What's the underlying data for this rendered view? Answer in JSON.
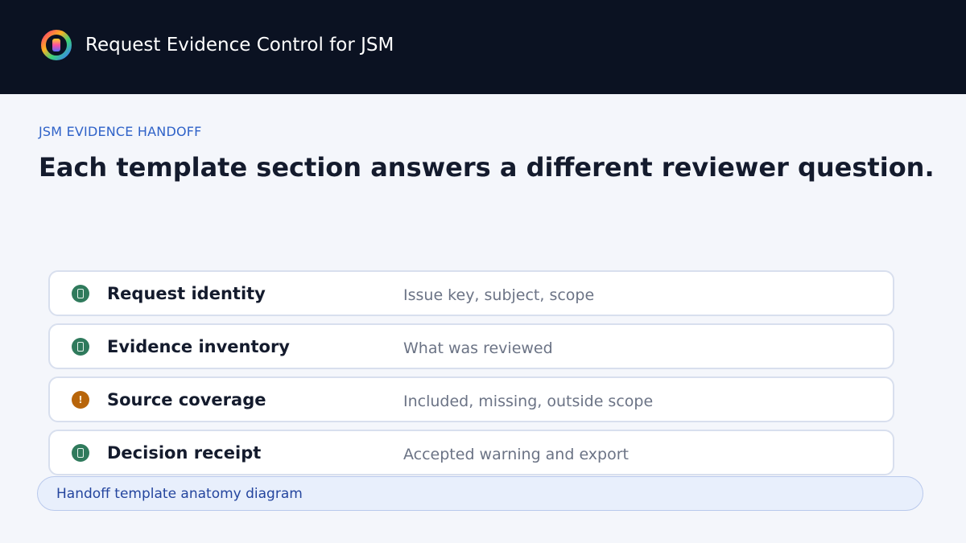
{
  "header": {
    "app_title": "Request Evidence Control for JSM",
    "logo_icon": "ring-logo-icon"
  },
  "main": {
    "eyebrow": "JSM EVIDENCE HANDOFF",
    "headline": "Each template section answers a different reviewer question.",
    "sections": [
      {
        "label": "Request identity",
        "description": "Issue key, subject, scope",
        "status": "ok",
        "status_icon": "check-icon"
      },
      {
        "label": "Evidence inventory",
        "description": "What was reviewed",
        "status": "ok",
        "status_icon": "check-icon"
      },
      {
        "label": "Source coverage",
        "description": "Included, missing, outside scope",
        "status": "warning",
        "status_icon": "warning-icon",
        "status_glyph": "!"
      },
      {
        "label": "Decision receipt",
        "description": "Accepted warning and export",
        "status": "ok",
        "status_icon": "check-icon"
      }
    ],
    "caption": "Handoff template anatomy diagram"
  },
  "colors": {
    "topbar_bg": "#0b1222",
    "page_bg": "#f4f6fb",
    "accent": "#2f62c8",
    "status_ok": "#2f7a5c",
    "status_warning": "#b8650a"
  }
}
